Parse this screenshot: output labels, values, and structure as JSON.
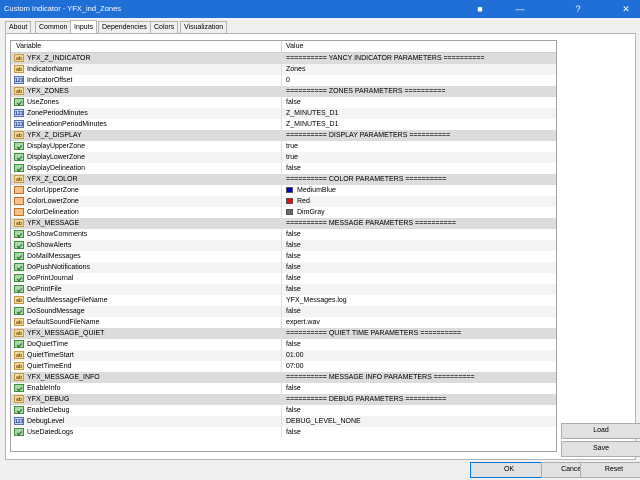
{
  "window": {
    "title": "Custom Indicator - YFX_ind_Zones",
    "controls": [
      "mql-icon",
      "minimize",
      "help",
      "close"
    ]
  },
  "tabs": [
    "About",
    "Common",
    "Inputs",
    "Dependencies",
    "Colors",
    "Visualization"
  ],
  "active_tab": "Inputs",
  "grid": {
    "col_variable": "Variable",
    "col_value": "Value",
    "rows": [
      {
        "type": "ab",
        "name": "YFX_Z_INDICATOR",
        "value": "========== YANCY INDICATOR PARAMETERS ==========",
        "section": true
      },
      {
        "type": "ab",
        "name": "IndicatorName",
        "value": "Zones"
      },
      {
        "type": "int",
        "name": "IndicatorOffset",
        "value": "0"
      },
      {
        "type": "ab",
        "name": "YFX_ZONES",
        "value": "========== ZONES PARAMETERS ==========",
        "section": true
      },
      {
        "type": "bool",
        "name": "UseZones",
        "value": "false"
      },
      {
        "type": "int",
        "name": "ZonePeriodMinutes",
        "value": "Z_MINUTES_D1"
      },
      {
        "type": "int",
        "name": "DelineationPeriodMinutes",
        "value": "Z_MINUTES_D1"
      },
      {
        "type": "ab",
        "name": "YFX_Z_DISPLAY",
        "value": "========== DISPLAY PARAMETERS ==========",
        "section": true
      },
      {
        "type": "bool",
        "name": "DisplayUpperZone",
        "value": "true"
      },
      {
        "type": "bool",
        "name": "DisplayLowerZone",
        "value": "true"
      },
      {
        "type": "bool",
        "name": "DisplayDelineation",
        "value": "false"
      },
      {
        "type": "ab",
        "name": "YFX_Z_COLOR",
        "value": "========== COLOR PARAMETERS ==========",
        "section": true
      },
      {
        "type": "color",
        "name": "ColorUpperZone",
        "value": "MediumBlue",
        "swatch": "#0000cd"
      },
      {
        "type": "color",
        "name": "ColorLowerZone",
        "value": "Red",
        "swatch": "#ff0000"
      },
      {
        "type": "color",
        "name": "ColorDelineation",
        "value": "DimGray",
        "swatch": "#696969"
      },
      {
        "type": "ab",
        "name": "YFX_MESSAGE",
        "value": "========== MESSAGE PARAMETERS ==========",
        "section": true
      },
      {
        "type": "bool",
        "name": "DoShowComments",
        "value": "false"
      },
      {
        "type": "bool",
        "name": "DoShowAlerts",
        "value": "false"
      },
      {
        "type": "bool",
        "name": "DoMailMessages",
        "value": "false"
      },
      {
        "type": "bool",
        "name": "DoPushNotifications",
        "value": "false"
      },
      {
        "type": "bool",
        "name": "DoPrintJournal",
        "value": "false"
      },
      {
        "type": "bool",
        "name": "DoPrintFile",
        "value": "false"
      },
      {
        "type": "ab",
        "name": "DefaultMessageFileName",
        "value": "YFX_Messages.log"
      },
      {
        "type": "bool",
        "name": "DoSoundMessage",
        "value": "false"
      },
      {
        "type": "ab",
        "name": "DefaultSoundFileName",
        "value": "expert.wav"
      },
      {
        "type": "ab",
        "name": "YFX_MESSAGE_QUIET",
        "value": "========== QUIET TIME PARAMETERS ==========",
        "section": true
      },
      {
        "type": "bool",
        "name": "DoQuietTime",
        "value": "false"
      },
      {
        "type": "ab",
        "name": "QuietTimeStart",
        "value": "01:00"
      },
      {
        "type": "ab",
        "name": "QuietTimeEnd",
        "value": "07:00"
      },
      {
        "type": "ab",
        "name": "YFX_MESSAGE_INFO",
        "value": "========== MESSAGE INFO PARAMETERS ==========",
        "section": true
      },
      {
        "type": "bool",
        "name": "EnableInfo",
        "value": "false"
      },
      {
        "type": "ab",
        "name": "YFX_DEBUG",
        "value": "========== DEBUG PARAMETERS ==========",
        "section": true
      },
      {
        "type": "bool",
        "name": "EnableDebug",
        "value": "false"
      },
      {
        "type": "int",
        "name": "DebugLevel",
        "value": "DEBUG_LEVEL_NONE"
      },
      {
        "type": "bool",
        "name": "UseDatedLogs",
        "value": "false"
      }
    ]
  },
  "buttons": {
    "load": "Load",
    "save": "Save",
    "ok": "OK",
    "cancel": "Cancel",
    "reset": "Reset"
  },
  "icon_labels": {
    "ab": "ab",
    "int": "123"
  }
}
